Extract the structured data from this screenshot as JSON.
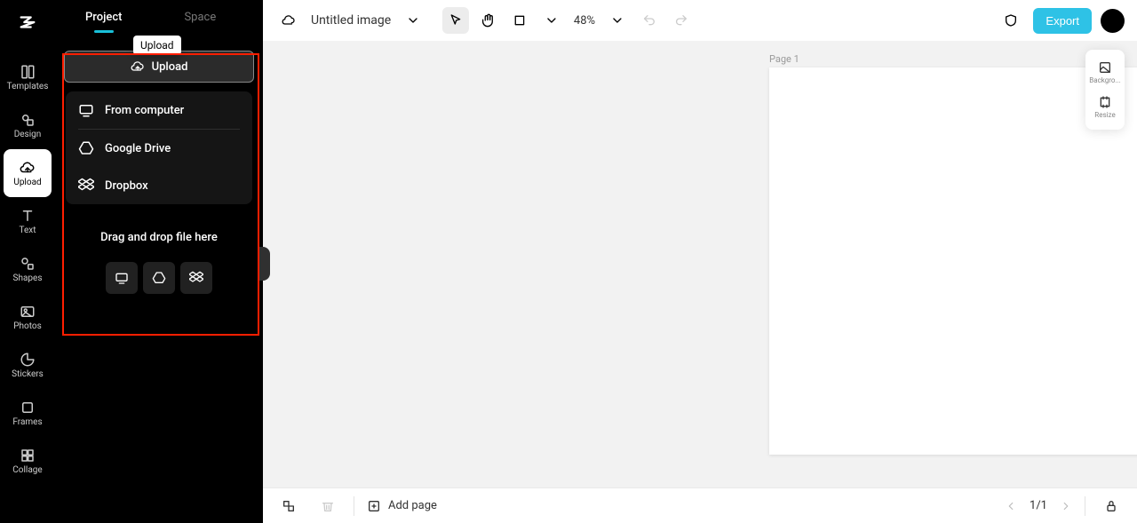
{
  "sidebar": {
    "items": [
      {
        "label": "Templates"
      },
      {
        "label": "Design"
      },
      {
        "label": "Upload"
      },
      {
        "label": "Text"
      },
      {
        "label": "Shapes"
      },
      {
        "label": "Photos"
      },
      {
        "label": "Stickers"
      },
      {
        "label": "Frames"
      },
      {
        "label": "Collage"
      }
    ]
  },
  "panel": {
    "tabs": [
      {
        "label": "Project"
      },
      {
        "label": "Space"
      }
    ],
    "tooltip": "Upload",
    "upload_button": "Upload",
    "menu": [
      {
        "label": "From computer"
      },
      {
        "label": "Google Drive"
      },
      {
        "label": "Dropbox"
      }
    ],
    "drop_text": "Drag and drop file here"
  },
  "topbar": {
    "title": "Untitled image",
    "zoom": "48%",
    "export": "Export"
  },
  "right_tools": [
    {
      "label": "Backgro..."
    },
    {
      "label": "Resize"
    }
  ],
  "canvas": {
    "page_label": "Page 1"
  },
  "bottombar": {
    "add_page": "Add page",
    "page": "1/1"
  }
}
